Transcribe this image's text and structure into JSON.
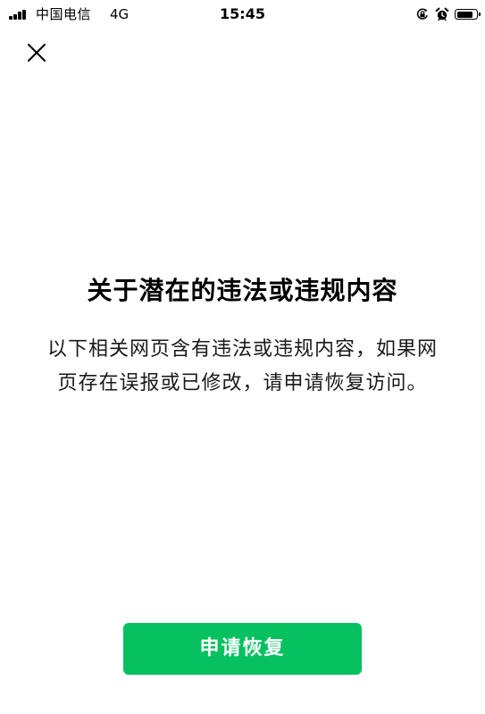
{
  "status_bar": {
    "carrier": "中国电信",
    "network": "4G",
    "time": "15:45",
    "battery_level": 0.85,
    "icons": [
      "signal-icon",
      "orientation-lock-icon",
      "alarm-icon",
      "battery-icon"
    ]
  },
  "nav": {
    "close_icon": "close-icon"
  },
  "content": {
    "title": "关于潜在的违法或违规内容",
    "description": "以下相关网页含有违法或违规内容，如果网页存在误报或已修改，请申请恢复访问。"
  },
  "actions": {
    "appeal_label": "申请恢复"
  },
  "colors": {
    "primary": "#07c160",
    "background": "#ffffff",
    "text": "#000000"
  }
}
